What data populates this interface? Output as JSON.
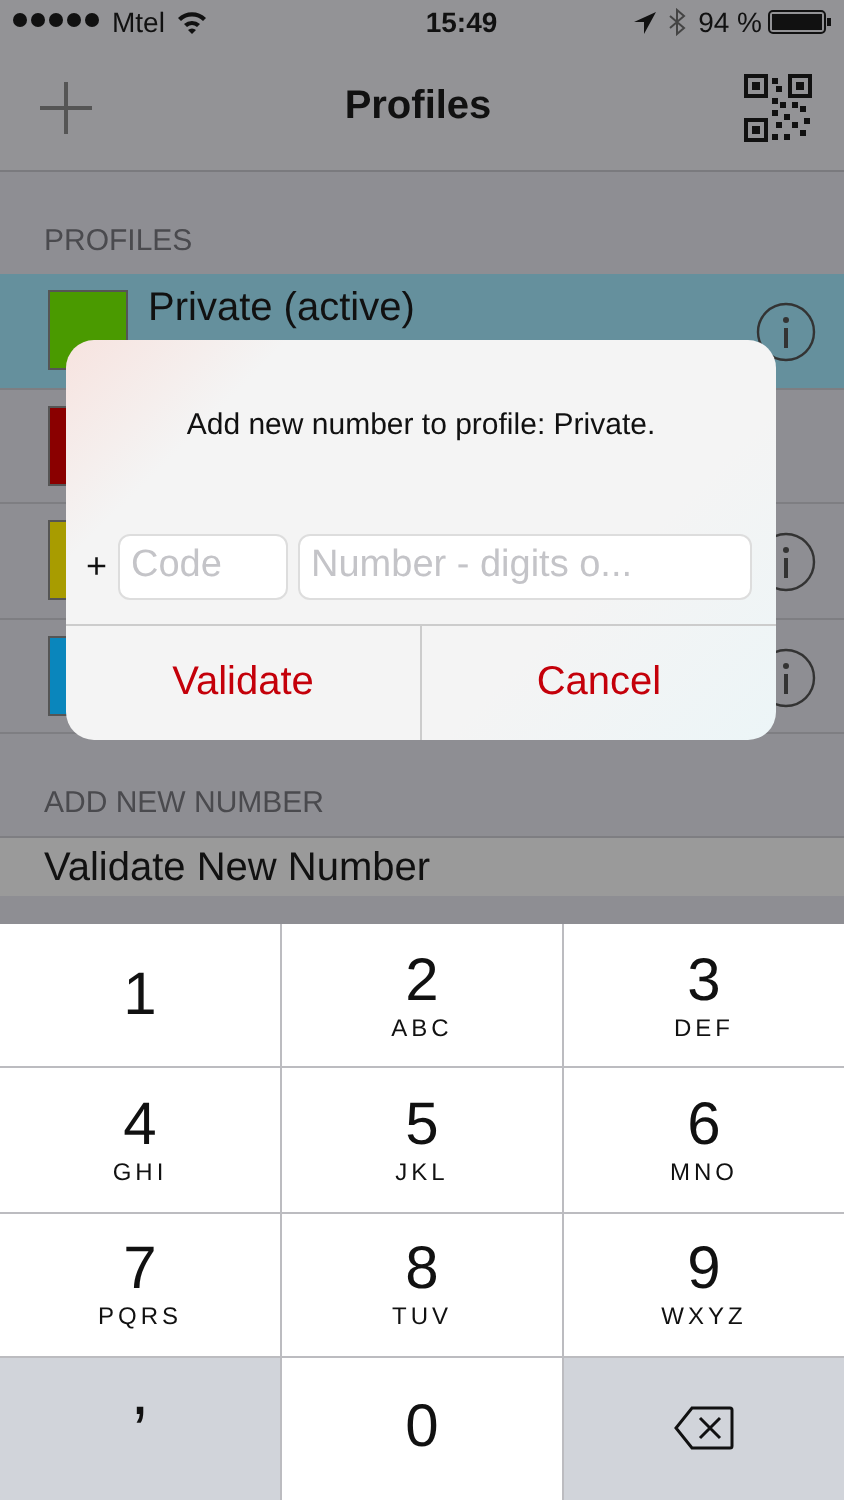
{
  "status_bar": {
    "carrier": "Mtel",
    "time": "15:49",
    "battery": "94 %"
  },
  "nav": {
    "title": "Profiles"
  },
  "profiles_section": {
    "header": "PROFILES",
    "rows": [
      {
        "name": "Private (active)",
        "color": "#4a9a00",
        "selected": true,
        "info": true
      },
      {
        "color": "#8a0000",
        "selected": false,
        "info": false
      },
      {
        "color": "#a89c00",
        "selected": false,
        "info": true
      },
      {
        "color": "#0a86bc",
        "selected": false,
        "info": true
      }
    ]
  },
  "add_section": {
    "header": "ADD NEW NUMBER",
    "row": "Validate New Number"
  },
  "dialog": {
    "message": "Add new number to profile: Private.",
    "prefix": "+",
    "code": {
      "placeholder": "Code"
    },
    "number": {
      "placeholder": "Number - digits o..."
    },
    "buttons": [
      "Validate",
      "Cancel"
    ]
  },
  "keyboard": [
    {
      "kind": "digit",
      "digit": "1"
    },
    {
      "kind": "digit",
      "digit": "2",
      "letters": "ABC"
    },
    {
      "kind": "digit",
      "digit": "3",
      "letters": "DEF"
    },
    {
      "kind": "digit",
      "digit": "4",
      "letters": "GHI"
    },
    {
      "kind": "digit",
      "digit": "5",
      "letters": "JKL"
    },
    {
      "kind": "digit",
      "digit": "6",
      "letters": "MNO"
    },
    {
      "kind": "digit",
      "digit": "7",
      "letters": "PQRS"
    },
    {
      "kind": "digit",
      "digit": "8",
      "letters": "TUV"
    },
    {
      "kind": "digit",
      "digit": "9",
      "letters": "WXYZ"
    },
    {
      "kind": "symbol",
      "digit": ","
    },
    {
      "kind": "digit",
      "digit": "0"
    },
    {
      "kind": "delete"
    }
  ]
}
